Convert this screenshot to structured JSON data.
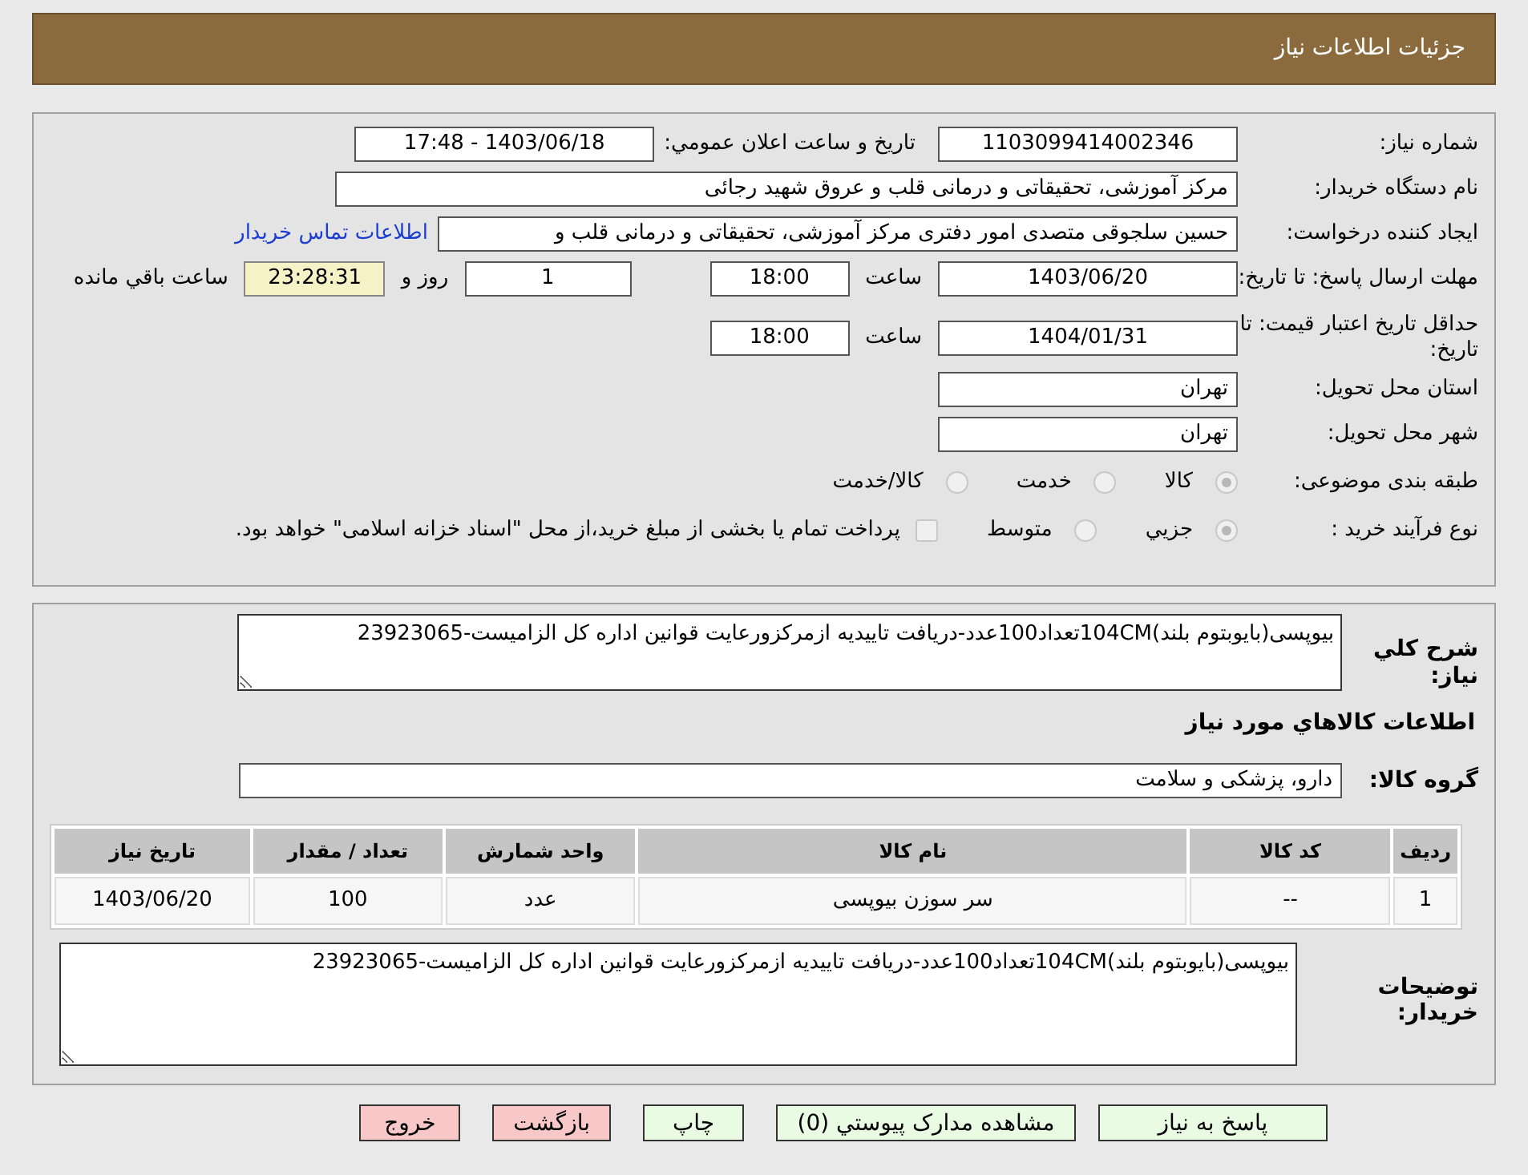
{
  "header": {
    "title": "جزئیات اطلاعات نیاز"
  },
  "need": {
    "need_number": {
      "label": "شماره نیاز:",
      "value": "1103099414002346"
    },
    "announce": {
      "label": "تاریخ و ساعت اعلان عمومي:",
      "value": "1403/06/18 - 17:48"
    },
    "buyer_org": {
      "label": "نام دستگاه خریدار:",
      "value": "مرکز آموزشی، تحقیقاتی و درمانی قلب و عروق شهید رجائی"
    },
    "requester": {
      "label": "ایجاد کننده درخواست:",
      "value": "حسین سلجوقی متصدی امور دفتری مرکز آموزشی، تحقیقاتی و درمانی قلب و",
      "contact_link": "اطلاعات تماس خریدار"
    },
    "deadline": {
      "label": "مهلت ارسال پاسخ: تا تاریخ:",
      "date": "1403/06/20",
      "time_label": "ساعت",
      "time": "18:00",
      "days": "1",
      "days_label": "روز و",
      "remaining": "23:28:31",
      "remaining_label": "ساعت باقي مانده"
    },
    "validity": {
      "label": "حداقل تاریخ اعتبار قیمت: تا تاریخ:",
      "date": "1404/01/31",
      "time_label": "ساعت",
      "time": "18:00"
    },
    "province": {
      "label": "استان محل تحویل:",
      "value": "تهران"
    },
    "city": {
      "label": "شهر محل تحویل:",
      "value": "تهران"
    },
    "category": {
      "label": "طبقه بندی موضوعی:",
      "options": [
        {
          "label": "کالا",
          "selected": true
        },
        {
          "label": "خدمت",
          "selected": false
        },
        {
          "label": "کالا/خدمت",
          "selected": false
        }
      ]
    },
    "purchase_type": {
      "label": "نوع فرآیند خرید :",
      "options": [
        {
          "label": "جزيي",
          "selected": true
        },
        {
          "label": "متوسط",
          "selected": false
        }
      ],
      "treasury": {
        "label": "پرداخت تمام یا بخشی از مبلغ خرید،از محل \"اسناد خزانه اسلامی\" خواهد بود.",
        "checked": false
      }
    }
  },
  "description": {
    "label": "شرح کلي نیاز:",
    "value": "بیوپسی(بایوبتوم بلند)104CMتعداد100عدد-دریافت تاییدیه ازمرکزورعایت قوانین اداره کل الزامیست-23923065"
  },
  "goods_heading": "اطلاعات کالاهاي مورد نیاز",
  "goods_group": {
    "label": "گروه کالا:",
    "value": "دارو، پزشکی و سلامت"
  },
  "table": {
    "columns": [
      "ردیف",
      "کد کالا",
      "نام کالا",
      "واحد شمارش",
      "تعداد / مقدار",
      "تاریخ نیاز"
    ],
    "rows": [
      [
        "1",
        "--",
        "سر سوزن بیوپسی",
        "عدد",
        "100",
        "1403/06/20"
      ]
    ]
  },
  "buyer_notes": {
    "label": "توضیحات خریدار:",
    "value": "بیوپسی(بایوبتوم بلند)104CMتعداد100عدد-دریافت تاییدیه ازمرکزورعایت قوانین اداره کل الزامیست-23923065"
  },
  "buttons": [
    {
      "label": "پاسخ به نیاز",
      "kind": "ok"
    },
    {
      "label": "مشاهده مدارک پیوستي (0)",
      "kind": "ok"
    },
    {
      "label": "چاپ",
      "kind": "ok"
    },
    {
      "label": "بازگشت",
      "kind": "danger"
    },
    {
      "label": "خروج",
      "kind": "danger"
    }
  ]
}
